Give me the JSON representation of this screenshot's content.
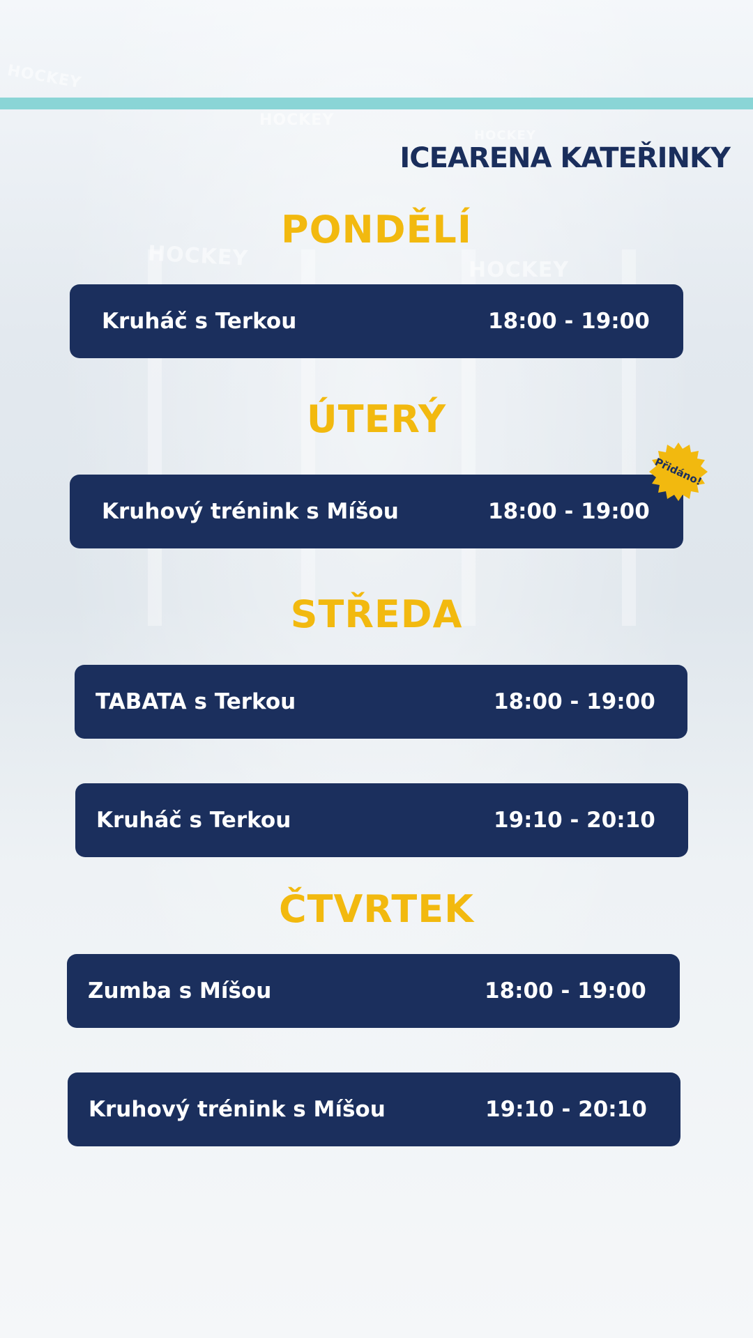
{
  "logo": "ICEARENA KATEŘINKY",
  "background_words": [
    "HOCKEY",
    "HOCKEY",
    "HOCKEY",
    "HOCKEY",
    "HOCKEY"
  ],
  "colors": {
    "accent_stripe": "#8ad5d6",
    "day_heading": "#f2b90f",
    "slot_bg": "#1b2f5d",
    "badge": "#f2b90f"
  },
  "days": [
    {
      "name": "PONDĚLÍ",
      "slots": [
        {
          "activity": "Kruháč s Terkou",
          "time": "18:00 - 19:00"
        }
      ]
    },
    {
      "name": "ÚTERÝ",
      "slots": [
        {
          "activity": "Kruhový trénink s Míšou",
          "time": "18:00 - 19:00",
          "badge": "Přidáno!"
        }
      ]
    },
    {
      "name": "STŘEDA",
      "slots": [
        {
          "activity": "TABATA s Terkou",
          "time": "18:00 - 19:00"
        },
        {
          "activity": "Kruháč s Terkou",
          "time": "19:10 - 20:10"
        }
      ]
    },
    {
      "name": "ČTVRTEK",
      "slots": [
        {
          "activity": "Zumba s Míšou",
          "time": "18:00 - 19:00"
        },
        {
          "activity": "Kruhový trénink s Míšou",
          "time": "19:10 - 20:10"
        }
      ]
    }
  ]
}
